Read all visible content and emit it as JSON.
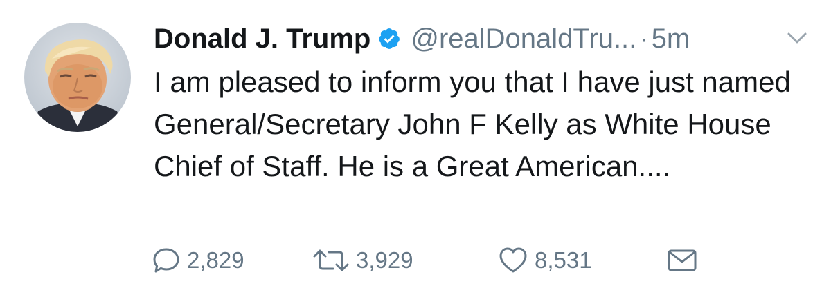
{
  "tweet": {
    "author": {
      "display_name": "Donald J. Trump",
      "verified": true,
      "handle": "@realDonaldTru...",
      "separator": "·",
      "time": "5m"
    },
    "text": "I am pleased to inform you that I have just named General/Secretary John F Kelly as White House Chief of Staff. He is a Great American....",
    "actions": {
      "replies": "2,829",
      "retweets": "3,929",
      "likes": "8,531"
    },
    "icons": {
      "menu": "chevron-down-icon",
      "verified": "verified-badge-icon",
      "reply": "reply-icon",
      "retweet": "retweet-icon",
      "like": "heart-icon",
      "message": "envelope-icon"
    },
    "colors": {
      "text": "#14171a",
      "secondary": "#657786",
      "verified_blue": "#1da1f2"
    }
  }
}
